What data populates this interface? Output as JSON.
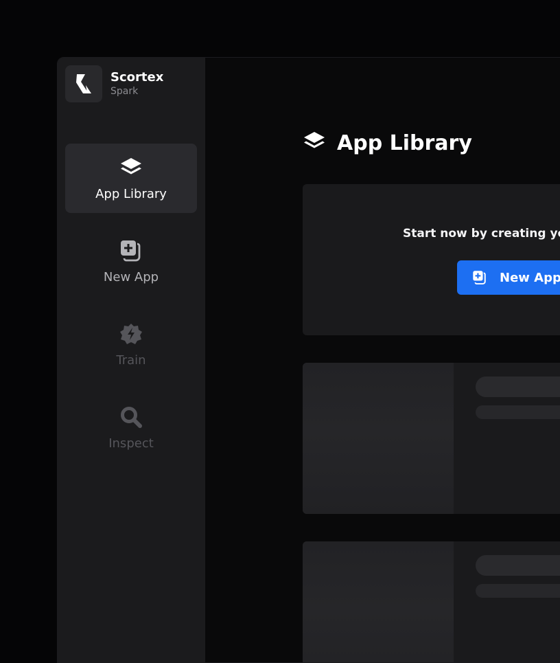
{
  "brand": {
    "name": "Scortex",
    "subtitle": "Spark",
    "logo_icon": "scortex-logo-icon"
  },
  "sidebar": {
    "items": [
      {
        "label": "App Library",
        "icon": "layers-icon",
        "state": "active"
      },
      {
        "label": "New App",
        "icon": "add-copy-icon",
        "state": "normal"
      },
      {
        "label": "Train",
        "icon": "bolt-gear-icon",
        "state": "disabled"
      },
      {
        "label": "Inspect",
        "icon": "search-icon",
        "state": "disabled"
      }
    ]
  },
  "main": {
    "title": "App Library",
    "title_icon": "layers-icon",
    "empty_state": {
      "text": "Start now by creating you",
      "button_label": "New Appl",
      "button_icon": "add-copy-icon"
    }
  },
  "colors": {
    "accent": "#1d6ff2",
    "sidebar_bg": "#1b1b1d",
    "active_item_bg": "#2a2a2e",
    "card_bg": "#1a1a1c",
    "page_bg": "#050506"
  }
}
